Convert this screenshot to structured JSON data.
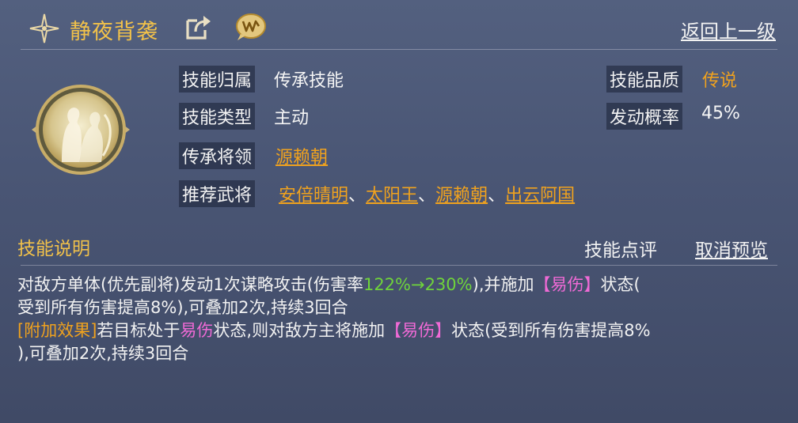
{
  "header": {
    "title": "静夜背袭",
    "back_label": "返回上一级"
  },
  "info": {
    "belong_label": "技能归属",
    "belong_value": "传承技能",
    "type_label": "技能类型",
    "type_value": "主动",
    "inherit_label": "传承将领",
    "inherit_value": "源赖朝",
    "recommend_label": "推荐武将",
    "recommend": [
      "安倍晴明",
      "太阳王",
      "源赖朝",
      "出云阿国"
    ],
    "recommend_sep": "、",
    "quality_label": "技能品质",
    "quality_value": "传说",
    "chance_label": "发动概率",
    "chance_value": "45%"
  },
  "section": {
    "title": "技能说明",
    "review_label": "技能点评",
    "cancel_label": "取消预览"
  },
  "description": {
    "line1_a": "对敌方单体(优先副将)发动1次谋略攻击(伤害率",
    "line1_rate": "122%→230%",
    "line1_b": "),并施加",
    "line1_status": "【易伤】",
    "line1_c": "状态(",
    "line2": "受到所有伤害提高8%),可叠加2次,持续3回合",
    "line3_tag": "[附加效果]",
    "line3_a": "若目标处于",
    "line3_cond": "易伤",
    "line3_b": "状态,则对敌方主将施加",
    "line3_status": "【易伤】",
    "line3_c": "状态(受到所有伤害提高8%",
    "line4": "),可叠加2次,持续3回合"
  },
  "colors": {
    "title_gold": "#f1c14a",
    "link_orange": "#f0a21e",
    "rate_green": "#6fd43b",
    "status_pink": "#f06ad6"
  },
  "icons": [
    "compass-star-icon",
    "share-icon",
    "chat-bubble-icon",
    "skill-portrait-icon"
  ]
}
